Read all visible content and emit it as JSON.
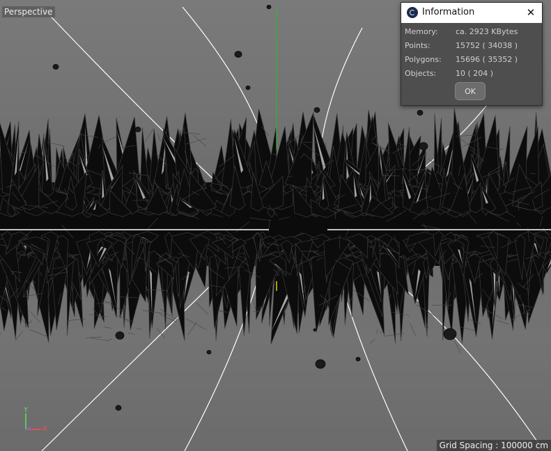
{
  "viewport": {
    "label": "Perspective",
    "grid_spacing": "Grid Spacing : 100000 cm",
    "axis_gizmo": {
      "y_label": "Y",
      "x_label": "X"
    }
  },
  "info_dialog": {
    "title": "Information",
    "close_glyph": "✕",
    "rows": [
      {
        "label": "Memory:",
        "value": "ca. 2923 KBytes"
      },
      {
        "label": "Points:",
        "value": "15752 ( 34038 )"
      },
      {
        "label": "Polygons:",
        "value": "15696 ( 35352 )"
      },
      {
        "label": "Objects:",
        "value": "10 ( 204 )"
      }
    ],
    "ok_label": "OK"
  },
  "colors": {
    "horizon_line": "#ffffff",
    "y_axis_line": "#22c422",
    "z_axis_marker": "#e0d000",
    "crystal_fill": "#0c0c0c",
    "crystal_edge": "#3a3a3a",
    "crystal_highlight": "#d8d8d8"
  }
}
